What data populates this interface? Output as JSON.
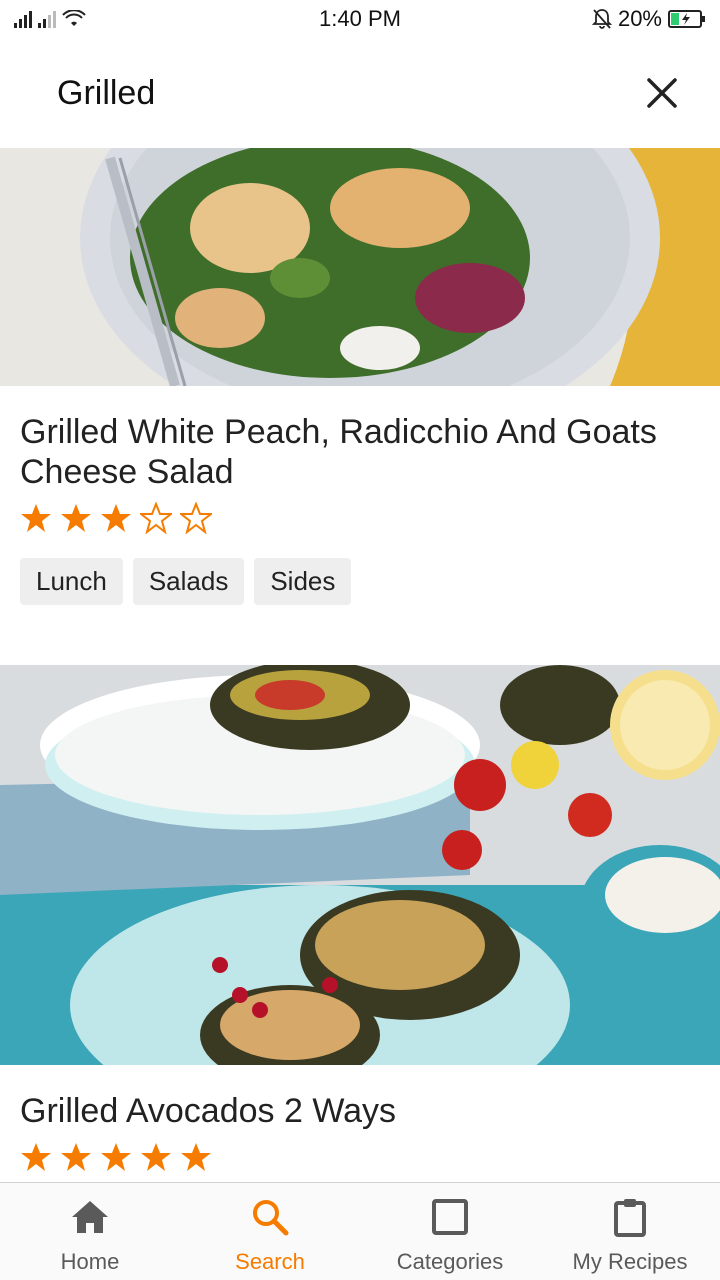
{
  "status_bar": {
    "time": "1:40 PM",
    "battery": "20%"
  },
  "search": {
    "query": "Grilled"
  },
  "results": [
    {
      "title": "Grilled White Peach, Radicchio And Goats Cheese Salad",
      "rating": 3,
      "max_rating": 5,
      "tags": [
        "Lunch",
        "Salads",
        "Sides"
      ]
    },
    {
      "title": "Grilled Avocados 2 Ways",
      "rating": 5,
      "max_rating": 5,
      "tags": []
    }
  ],
  "bottom_nav": {
    "items": [
      {
        "label": "Home",
        "icon": "home-icon",
        "active": false
      },
      {
        "label": "Search",
        "icon": "search-icon",
        "active": true
      },
      {
        "label": "Categories",
        "icon": "square-icon",
        "active": false
      },
      {
        "label": "My Recipes",
        "icon": "clipboard-icon",
        "active": false
      }
    ]
  },
  "colors": {
    "accent": "#f57c00",
    "star": "#f57c00",
    "nav_inactive": "#5a5a5a",
    "tag_bg": "#eeeeee"
  }
}
